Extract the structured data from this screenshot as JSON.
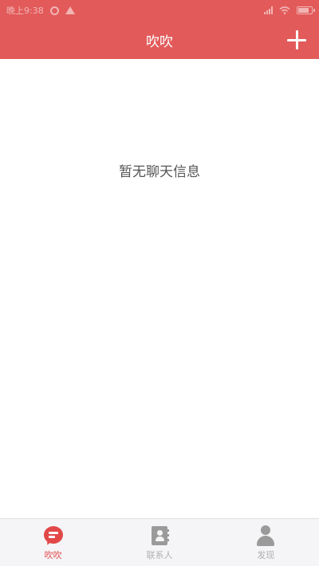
{
  "status_bar": {
    "time": "晚上9:38"
  },
  "header": {
    "title": "吹吹",
    "add_icon": "plus-icon"
  },
  "main": {
    "empty_message": "暂无聊天信息"
  },
  "bottom_nav": {
    "items": [
      {
        "label": "吹吹",
        "icon": "chat-bubble-icon",
        "active": true
      },
      {
        "label": "联系人",
        "icon": "contacts-book-icon",
        "active": false
      },
      {
        "label": "发现",
        "icon": "person-icon",
        "active": false
      }
    ]
  },
  "colors": {
    "primary": "#e25a5a",
    "active_tab": "#e24848",
    "inactive_tab": "#b0b0b0",
    "nav_background": "#f5f5f7"
  }
}
